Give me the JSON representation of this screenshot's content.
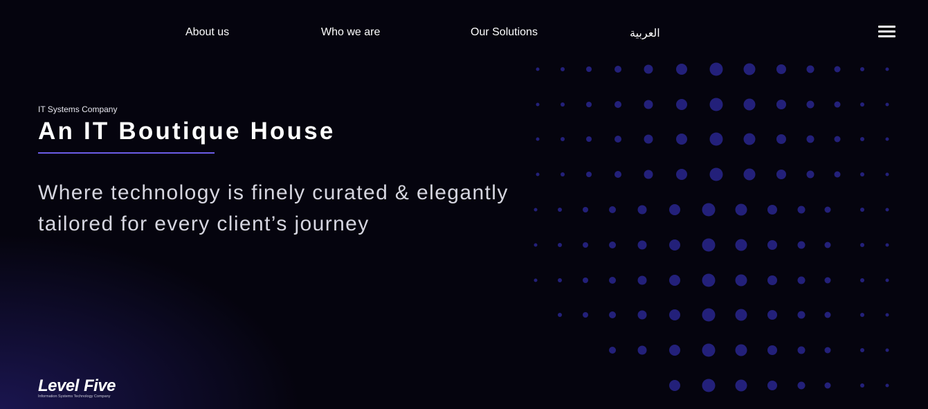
{
  "nav": {
    "items": [
      {
        "label": "About us"
      },
      {
        "label": "Who we are"
      },
      {
        "label": "Our Solutions"
      },
      {
        "label": "العربية"
      }
    ]
  },
  "menu_icon": "hamburger-menu-icon",
  "hero": {
    "eyebrow": "IT Systems Company",
    "title": "An IT Boutique House",
    "tagline": "Where technology is finely curated & elegantly tailored for every client’s journey"
  },
  "brand": {
    "logo_text": "LevelFive",
    "logo_tagline": "Information Systems Technology Company"
  },
  "colors": {
    "background": "#05040e",
    "accent": "#6c5ce7",
    "dots": "#23207a"
  }
}
